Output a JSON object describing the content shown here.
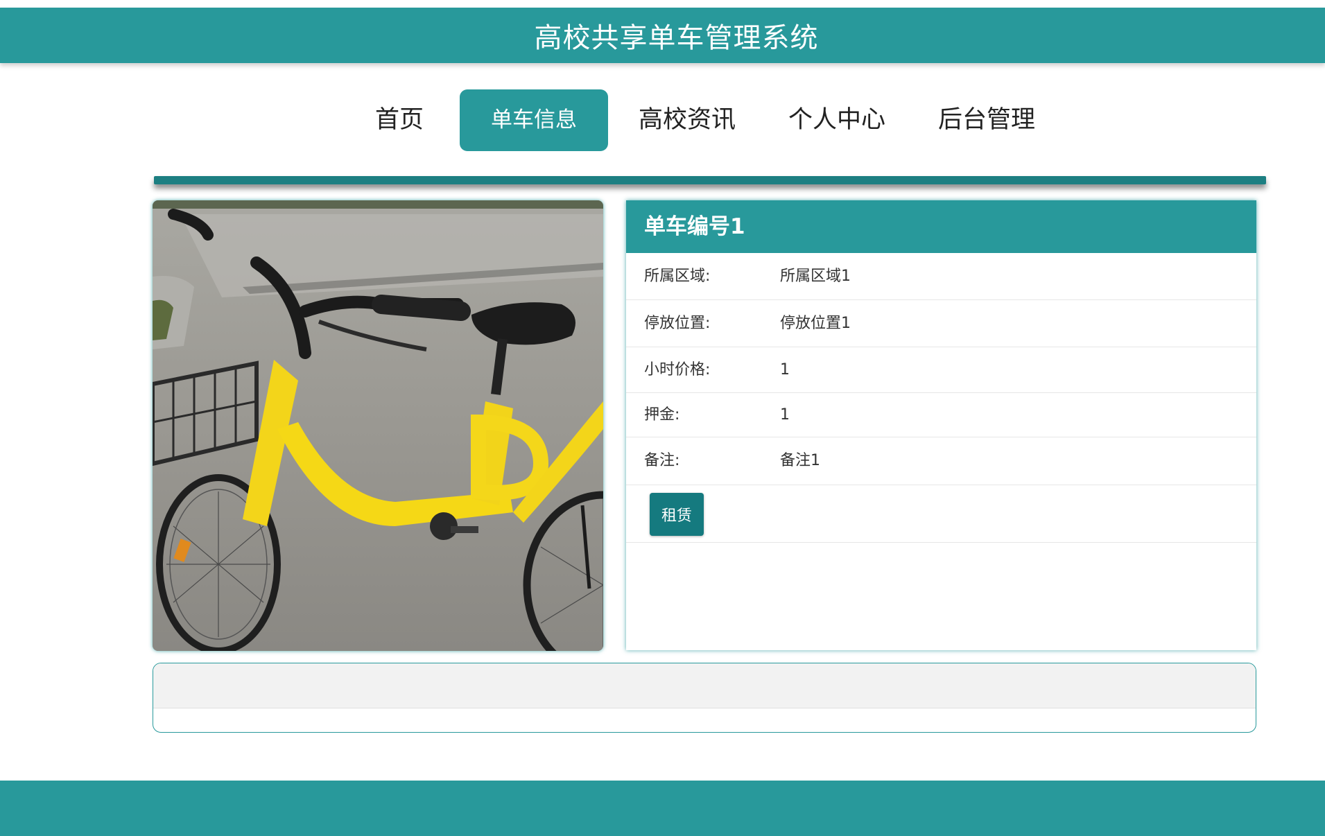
{
  "app": {
    "title": "高校共享单车管理系统"
  },
  "nav": [
    {
      "label": "首页",
      "active": false
    },
    {
      "label": "单车信息",
      "active": true
    },
    {
      "label": "高校资讯",
      "active": false
    },
    {
      "label": "个人中心",
      "active": false
    },
    {
      "label": "后台管理",
      "active": false
    }
  ],
  "colors": {
    "primary": "#28999b",
    "button": "#157a7f",
    "divider": "#1d7f82"
  },
  "bike": {
    "photo_icon": "yellow-bike-photo",
    "title": "单车编号1",
    "details": [
      {
        "label": "所属区域:",
        "value": "所属区域1"
      },
      {
        "label": "停放位置:",
        "value": "停放位置1"
      },
      {
        "label": "小时价格:",
        "value": "1"
      },
      {
        "label": "押金:",
        "value": "1"
      },
      {
        "label": "备注:",
        "value": "备注1"
      }
    ],
    "rent_label": "租赁"
  }
}
